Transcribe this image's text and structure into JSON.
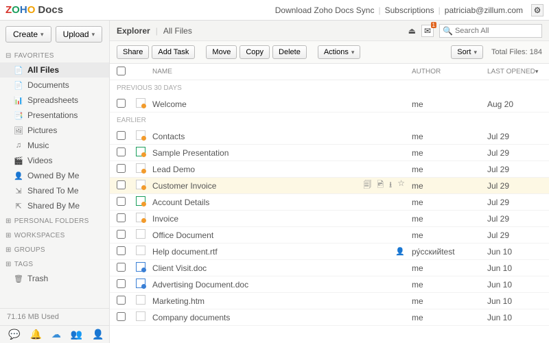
{
  "topbar": {
    "download": "Download Zoho Docs Sync",
    "subscriptions": "Subscriptions",
    "email": "patriciab@zillum.com"
  },
  "sidebar": {
    "create": "Create",
    "upload": "Upload",
    "sections": {
      "favorites": "FAVORITES",
      "personal": "PERSONAL FOLDERS",
      "workspaces": "WORKSPACES",
      "groups": "GROUPS",
      "tags": "TAGS"
    },
    "items": [
      {
        "label": "All Files",
        "icon": "📄"
      },
      {
        "label": "Documents",
        "icon": "📄"
      },
      {
        "label": "Spreadsheets",
        "icon": "📊"
      },
      {
        "label": "Presentations",
        "icon": "📑"
      },
      {
        "label": "Pictures",
        "icon": "🖼"
      },
      {
        "label": "Music",
        "icon": "♫"
      },
      {
        "label": "Videos",
        "icon": "🎬"
      },
      {
        "label": "Owned By Me",
        "icon": "👤"
      },
      {
        "label": "Shared To Me",
        "icon": "⇲"
      },
      {
        "label": "Shared By Me",
        "icon": "⇱"
      }
    ],
    "trash": "Trash",
    "storage": "71.16 MB Used"
  },
  "breadcrumb": {
    "root": "Explorer",
    "current": "All Files"
  },
  "notif_count": "1",
  "search_placeholder": "Search All",
  "toolbar": {
    "share": "Share",
    "add_task": "Add Task",
    "move": "Move",
    "copy": "Copy",
    "delete": "Delete",
    "actions": "Actions",
    "sort": "Sort",
    "total_label": "Total Files:",
    "total_count": "184"
  },
  "columns": {
    "name": "NAME",
    "author": "AUTHOR",
    "opened": "LAST OPENED"
  },
  "groups": [
    {
      "label": "PREVIOUS 30 DAYS",
      "files": [
        {
          "name": "Welcome",
          "author": "me",
          "date": "Aug 20",
          "ico": "fire"
        }
      ]
    },
    {
      "label": "EARLIER",
      "files": [
        {
          "name": "Contacts",
          "author": "me",
          "date": "Jul 29",
          "ico": "fire"
        },
        {
          "name": "Sample Presentation",
          "author": "me",
          "date": "Jul 29",
          "ico": "sheet"
        },
        {
          "name": "Lead Demo",
          "author": "me",
          "date": "Jul 29",
          "ico": "fire"
        },
        {
          "name": "Customer Invoice",
          "author": "me",
          "date": "Jul 29",
          "ico": "fire",
          "highlight": true,
          "actions": true
        },
        {
          "name": "Account Details",
          "author": "me",
          "date": "Jul 29",
          "ico": "sheet"
        },
        {
          "name": "Invoice",
          "author": "me",
          "date": "Jul 29",
          "ico": "fire"
        },
        {
          "name": "Office Document",
          "author": "me",
          "date": "Jul 29",
          "ico": "plain"
        },
        {
          "name": "Help document.rtf",
          "author": "ру́сскийtest",
          "date": "Jun 10",
          "ico": "plain",
          "shared": true
        },
        {
          "name": "Client Visit.doc",
          "author": "me",
          "date": "Jun 10",
          "ico": "doc"
        },
        {
          "name": "Advertising Document.doc",
          "author": "me",
          "date": "Jun 10",
          "ico": "doc"
        },
        {
          "name": "Marketing.htm",
          "author": "me",
          "date": "Jun 10",
          "ico": "plain"
        },
        {
          "name": "Company documents",
          "author": "me",
          "date": "Jun 10",
          "ico": "plain"
        }
      ]
    }
  ]
}
